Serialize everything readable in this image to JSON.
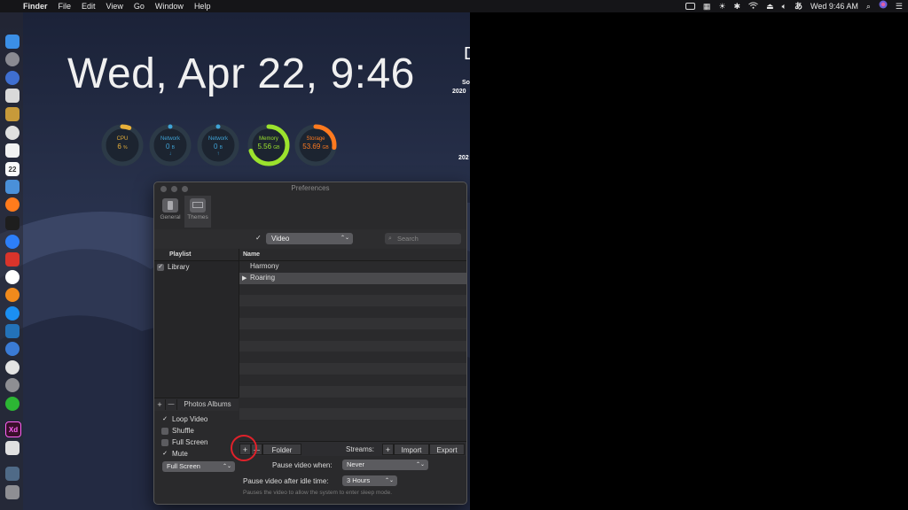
{
  "menubar": {
    "apple": "",
    "app_name": "Finder",
    "items": [
      "File",
      "Edit",
      "View",
      "Go",
      "Window",
      "Help"
    ],
    "clock": "Wed 9:46 AM",
    "status_icons": [
      "screen-mirror-icon",
      "keyboard-icon",
      "brightness-icon",
      "bluetooth-icon",
      "wifi-icon",
      "airplay-icon",
      "volume-icon",
      "text-input-icon",
      "spotlight-icon",
      "siri-icon",
      "notification-center-icon"
    ]
  },
  "desktop": {
    "clock_text": "Wed, Apr 22, 9:46",
    "gauges": [
      {
        "label": "CPU",
        "value": "6",
        "unit": "%",
        "sub": "",
        "color": "#e8b03a",
        "level": 0.06
      },
      {
        "label": "Network",
        "value": "0",
        "unit": "B",
        "sub": "↓",
        "color": "#3fa3d6",
        "level": 0
      },
      {
        "label": "Network",
        "value": "0",
        "unit": "B",
        "sub": "↑",
        "color": "#3fa3d6",
        "level": 0
      },
      {
        "label": "Memory",
        "value": "5.56",
        "unit": "GB",
        "sub": "",
        "color": "#9be22d",
        "level": 0.7
      },
      {
        "label": "Storage",
        "value": "53.69",
        "unit": "GB",
        "sub": "",
        "color": "#ff7a1f",
        "level": 0.27
      }
    ],
    "side_widget": {
      "letter": "D",
      "line1": "So",
      "line2": "2020",
      "line3": "202"
    }
  },
  "dock": {
    "icons": [
      "finder-icon",
      "launchpad-icon",
      "safari-icon",
      "photos-icon",
      "keynote-icon",
      "chrome-icon",
      "notes-icon",
      "calendar-icon",
      "preview-icon",
      "firefox-icon",
      "terminal-icon",
      "messenger-icon",
      "acrobat-icon",
      "slack-icon",
      "books-icon",
      "app-store-icon",
      "vscode-icon",
      "location-icon",
      "itunes-icon",
      "system-preferences-icon",
      "line-icon",
      "adobe-xd-icon",
      "disk-utility-icon",
      "downloads-folder-icon",
      "trash-icon"
    ],
    "calendar_day": "22",
    "xd_label": "Xd"
  },
  "prefs": {
    "title": "Preferences",
    "tabs": [
      {
        "label": "General"
      },
      {
        "label": "Themes"
      }
    ],
    "filter": {
      "check": "✓",
      "type_value": "Video",
      "search_placeholder": "Search"
    },
    "playlist": {
      "header": "Playlist",
      "items": [
        {
          "label": "Library",
          "checked": true
        }
      ],
      "plus": "+",
      "minus": "—",
      "photos_albums": "Photos Albums"
    },
    "names": {
      "header": "Name",
      "rows": [
        {
          "label": "Harmony",
          "expand": ""
        },
        {
          "label": "Roaring",
          "expand": "▶"
        }
      ]
    },
    "options": {
      "loop_video": "Loop Video",
      "shuffle": "Shuffle",
      "full_screen": "Full Screen",
      "mute": "Mute",
      "fill_mode": "Full Screen",
      "loop_checked": true,
      "shuffle_checked": false,
      "full_screen_checked": false,
      "mute_checked": true
    },
    "bottom": {
      "plus": "+",
      "minus": "—",
      "folder": "Folder",
      "streams_label": "Streams:",
      "streams_plus": "+",
      "import": "Import",
      "export": "Export"
    },
    "pause_when": {
      "label": "Pause video when:",
      "value": "Never"
    },
    "pause_idle": {
      "label": "Pause video after idle time:",
      "value": "3 Hours"
    },
    "hint": "Pauses the video to allow the system to enter sleep mode."
  }
}
